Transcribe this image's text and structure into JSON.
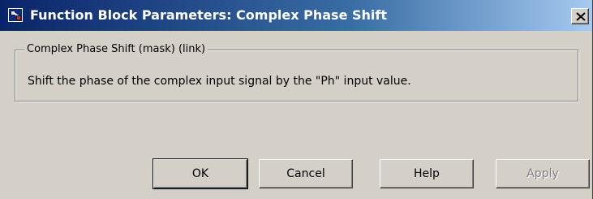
{
  "window": {
    "title": "Function Block Parameters: Complex Phase Shift",
    "title_icon": "simulink-block-icon",
    "close_icon": "close-icon"
  },
  "group": {
    "legend": "Complex Phase Shift (mask) (link)",
    "description": "Shift the phase of the complex input signal by the \"Ph\" input value."
  },
  "buttons": {
    "ok": "OK",
    "cancel": "Cancel",
    "help": "Help",
    "apply": "Apply"
  },
  "states": {
    "apply_enabled": false,
    "default_button": "OK"
  },
  "colors": {
    "titlebar_start": "#0a246a",
    "titlebar_end": "#a6caf0",
    "face": "#d4d0c8"
  }
}
